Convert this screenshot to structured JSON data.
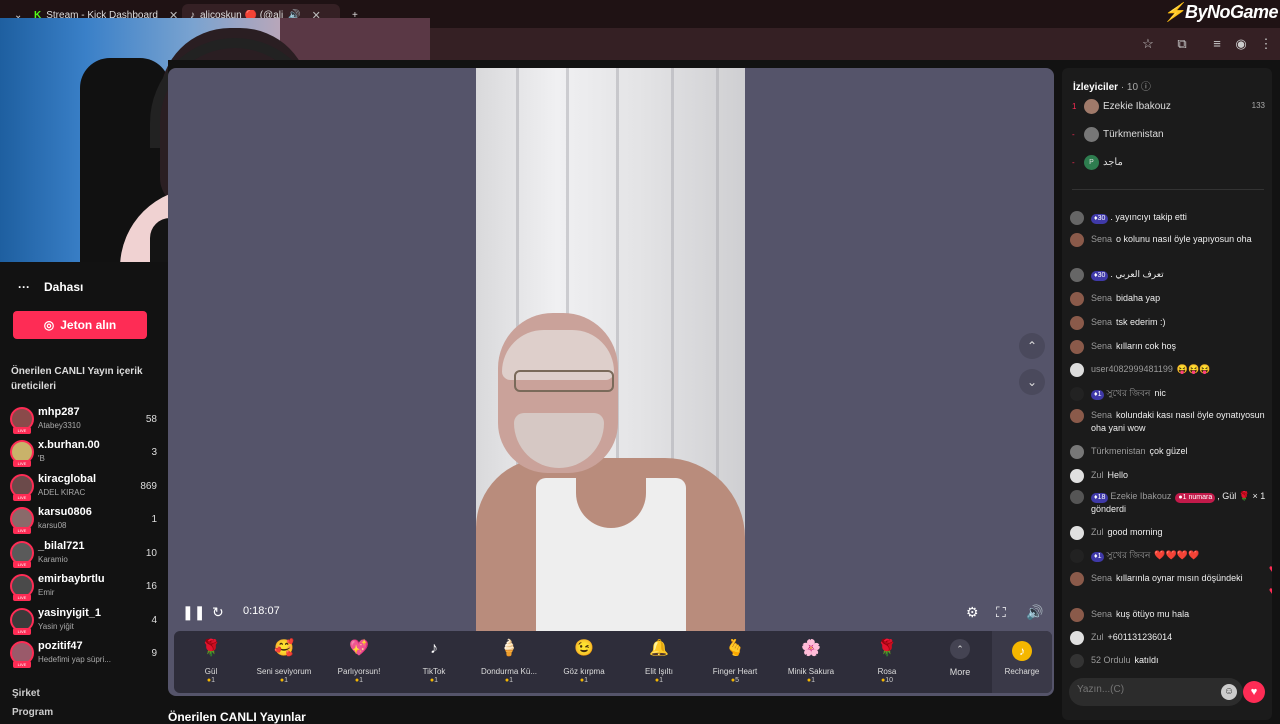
{
  "browser": {
    "tabs": [
      {
        "label": "Stream - Kick Dashboard"
      },
      {
        "label": "alicoşkun 🔴 (@ali"
      }
    ],
    "brand": "ByNoGame"
  },
  "sidebar": {
    "more_label": "Dahası",
    "coin_button": "Jeton alın",
    "suggested_title": "Önerilen CANLI Yayın içerik üreticileri",
    "creators": [
      {
        "name": "mhp287",
        "sub": "Atabey3310",
        "count": "58",
        "color": "#8a4a4a"
      },
      {
        "name": "x.burhan.00",
        "sub": "'B",
        "count": "3",
        "color": "#c9b26a"
      },
      {
        "name": "kiracglobal",
        "sub": "ADEL KIRAC",
        "count": "869",
        "color": "#6b4a4a"
      },
      {
        "name": "karsu0806",
        "sub": "karsu08",
        "count": "1",
        "color": "#8a6a6a"
      },
      {
        "name": "_bilal721",
        "sub": "Karamio",
        "count": "10",
        "color": "#5a5a5a"
      },
      {
        "name": "emirbaybrtlu",
        "sub": "Emir",
        "count": "16",
        "color": "#4a4a4a"
      },
      {
        "name": "yasinyigit_1",
        "sub": "Yasin yiğit",
        "count": "4",
        "color": "#3a3a3a"
      },
      {
        "name": "pozitif47",
        "sub": "Hedefimi yap süpri...",
        "count": "9",
        "color": "#9a5a6a"
      }
    ],
    "footer": [
      "Şirket",
      "Program"
    ]
  },
  "player": {
    "timecode": "0:18:07"
  },
  "gifts": [
    {
      "name": "Gül",
      "price": "1",
      "icon": "🌹"
    },
    {
      "name": "Seni seviyorum",
      "price": "1",
      "icon": "🥰"
    },
    {
      "name": "Parlıyorsun!",
      "price": "1",
      "icon": "💖"
    },
    {
      "name": "TikTok",
      "price": "1",
      "icon": "♪"
    },
    {
      "name": "Dondurma Kü...",
      "price": "1",
      "icon": "🍦"
    },
    {
      "name": "Göz kırpma",
      "price": "1",
      "icon": "😉"
    },
    {
      "name": "Elit Işıltı",
      "price": "1",
      "icon": "🔔"
    },
    {
      "name": "Finger Heart",
      "price": "5",
      "icon": "🫰"
    },
    {
      "name": "Minik Sakura",
      "price": "1",
      "icon": "🌸"
    },
    {
      "name": "Rosa",
      "price": "10",
      "icon": "🌹"
    }
  ],
  "gift_more": "More",
  "recharge": "Recharge",
  "below_title": "Önerilen CANLI Yayınlar",
  "chat": {
    "viewers_title": "İzleyiciler",
    "viewers_count": "· 10",
    "viewers": [
      {
        "rank": "1",
        "name": "Ezekie Ibakouz",
        "score": "133"
      },
      {
        "rank": "-",
        "name": "Türkmenistan",
        "score": ""
      },
      {
        "rank": "-",
        "name": "ماجد",
        "score": "",
        "initial": "P"
      }
    ],
    "messages": [
      {
        "badge": "30",
        "name": "",
        "text": ". yayıncıyı takip etti"
      },
      {
        "name": "Sena",
        "text": "o kolunu nasıl öyle yapıyosun oha"
      },
      {
        "badge": "30",
        "name": "",
        "text": ". تعرف العربي"
      },
      {
        "name": "Sena",
        "text": "bidaha yap"
      },
      {
        "name": "Sena",
        "text": "tsk ederim :)"
      },
      {
        "name": "Sena",
        "text": "kılların cok hoş"
      },
      {
        "name": "user4082999481199",
        "text": "😝😝😝"
      },
      {
        "badge": "1",
        "name": "সুখের জিবন",
        "text": "nic"
      },
      {
        "name": "Sena",
        "text": "kolundaki kası nasıl öyle oynatıyosun oha yani wow"
      },
      {
        "name": "Türkmenistan",
        "text": "çok güzel"
      },
      {
        "name": "Zul",
        "text": "Hello"
      },
      {
        "badge": "18",
        "name": "Ezekie Ibakouz",
        "rank": "1 numara",
        "text": ", Gül 🌹 × 1 gönderdi"
      },
      {
        "name": "Zul",
        "text": "good morning"
      },
      {
        "badge": "1",
        "name": "সুখের জিবন",
        "text": "❤️❤️❤️❤️"
      },
      {
        "name": "Sena",
        "text": "kıllarınla oynar mısın döşündeki"
      },
      {
        "name": "Sena",
        "text": "kuş ötüyo mu hala"
      },
      {
        "name": "Zul",
        "text": "+601131236014"
      },
      {
        "name": "52 Ordulu",
        "text": "katıldı"
      }
    ],
    "input_placeholder": "Yazın...(C)"
  }
}
